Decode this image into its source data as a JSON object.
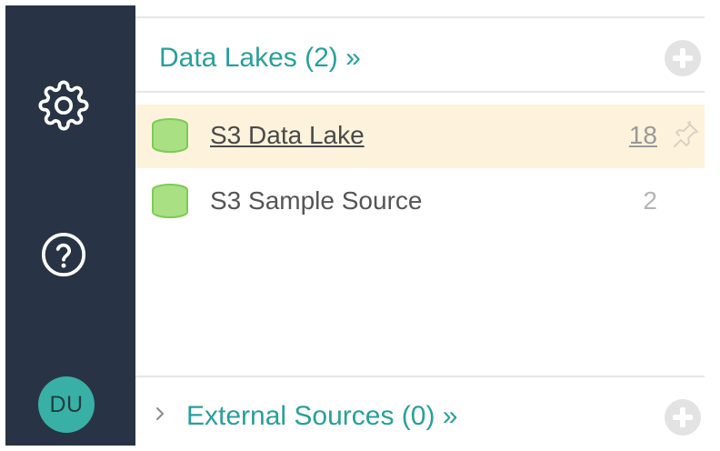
{
  "sidebar": {
    "user_initials": "DU",
    "icons": [
      "gear-icon",
      "help-circle-icon"
    ]
  },
  "data_lakes": {
    "title": "Data Lakes (2) »",
    "items": [
      {
        "label": "S3 Data Lake",
        "count": "18",
        "highlighted": true,
        "icon": "database-icon"
      },
      {
        "label": "S3 Sample Source",
        "count": "2",
        "highlighted": false,
        "icon": "database-icon"
      }
    ]
  },
  "external_sources": {
    "title": "External Sources (0) »",
    "expanded": false
  },
  "colors": {
    "sidebar_bg": "#283445",
    "accent": "#2a9f9a",
    "avatar": "#39b0a6",
    "highlight_row": "#fdf3dc",
    "database_icon": "#8fd46a"
  }
}
